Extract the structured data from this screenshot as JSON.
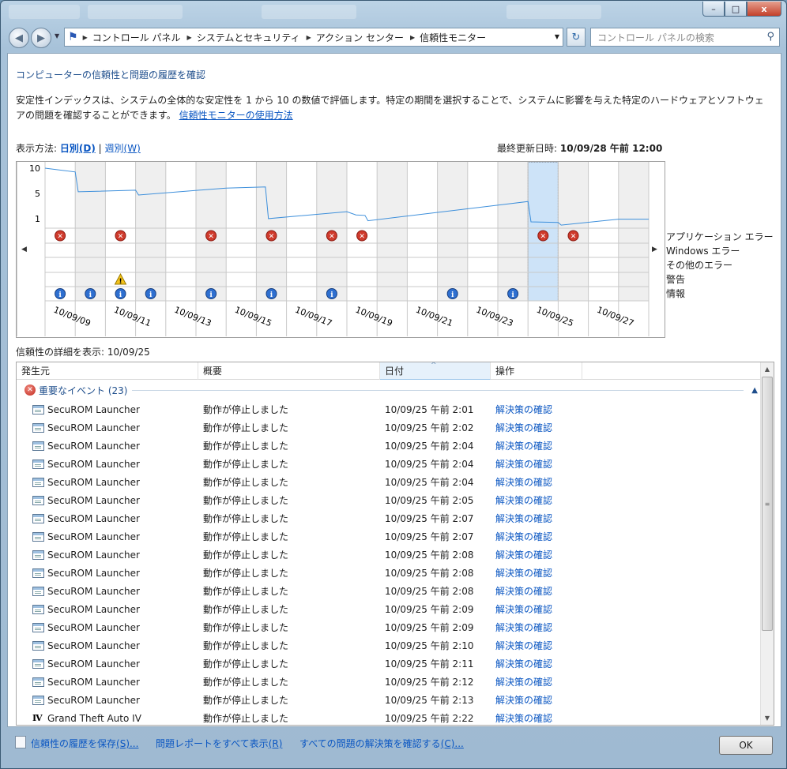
{
  "window": {
    "breadcrumbs": [
      "コントロール パネル",
      "システムとセキュリティ",
      "アクション センター",
      "信頼性モニター"
    ],
    "search_placeholder": "コントロール パネルの検索",
    "controls": {
      "minimize": "–",
      "maximize": "□",
      "close": "x"
    }
  },
  "page": {
    "title": "コンピューターの信頼性と問題の履歴を確認",
    "description": "安定性インデックスは、システムの全体的な安定性を 1 から 10 の数値で評価します。特定の期間を選択することで、システムに影響を与えた特定のハードウェアとソフトウェアの問題を確認することができます。",
    "help_link": "信頼性モニターの使用方法",
    "view_by_label": "表示方法:",
    "view_daily": "日別",
    "view_daily_key": "(D)",
    "view_weekly": "週別",
    "view_weekly_key": "(W)",
    "view_sep": "|",
    "last_updated_label": "最終更新日時:",
    "last_updated_value": "10/09/28 午前 12:00",
    "details_label": "信頼性の詳細を表示: 10/09/25"
  },
  "chart_data": {
    "type": "line",
    "y_ticks": [
      "10",
      "5",
      "1"
    ],
    "ylim": [
      1,
      10
    ],
    "x_labels": [
      "10/09/09",
      "10/09/11",
      "10/09/13",
      "10/09/15",
      "10/09/17",
      "10/09/19",
      "10/09/21",
      "10/09/23",
      "10/09/25",
      "10/09/27"
    ],
    "days": 20,
    "selected_day_index": 16,
    "stability_points": [
      [
        0,
        10
      ],
      [
        1,
        9.3
      ],
      [
        1.1,
        5.6
      ],
      [
        3,
        5.9
      ],
      [
        3.1,
        5.0
      ],
      [
        6,
        6.3
      ],
      [
        7.3,
        6.5
      ],
      [
        7.4,
        0.6
      ],
      [
        10,
        1.9
      ],
      [
        10.3,
        1.3
      ],
      [
        10.6,
        1.2
      ],
      [
        10.7,
        0.2
      ],
      [
        16,
        3.8
      ],
      [
        16.1,
        0.0
      ],
      [
        17,
        -0.1
      ],
      [
        17.1,
        -0.6
      ],
      [
        19,
        0.5
      ],
      [
        20,
        0.5
      ]
    ],
    "legend": [
      "アプリケーション エラー",
      "Windows エラー",
      "その他のエラー",
      "警告",
      "情報"
    ],
    "events": {
      "application_errors": [
        0,
        2,
        5,
        7,
        9,
        10,
        16,
        17
      ],
      "windows_errors": [],
      "other_errors": [],
      "warnings": [
        2
      ],
      "information": [
        0,
        1,
        2,
        3,
        5,
        7,
        9,
        13,
        15
      ]
    },
    "series": [
      {
        "name": "安定性インデックス",
        "color": "#3d8fdb"
      }
    ]
  },
  "table": {
    "columns": [
      "発生元",
      "概要",
      "日付",
      "操作"
    ],
    "group_label": "重要なイベント (23)",
    "rows": [
      {
        "source": "SecuROM Launcher",
        "summary": "動作が停止しました",
        "date": "10/09/25 午前 2:01",
        "action": "解決策の確認",
        "icon": "app-icon"
      },
      {
        "source": "SecuROM Launcher",
        "summary": "動作が停止しました",
        "date": "10/09/25 午前 2:02",
        "action": "解決策の確認",
        "icon": "app-icon"
      },
      {
        "source": "SecuROM Launcher",
        "summary": "動作が停止しました",
        "date": "10/09/25 午前 2:04",
        "action": "解決策の確認",
        "icon": "app-icon"
      },
      {
        "source": "SecuROM Launcher",
        "summary": "動作が停止しました",
        "date": "10/09/25 午前 2:04",
        "action": "解決策の確認",
        "icon": "app-icon"
      },
      {
        "source": "SecuROM Launcher",
        "summary": "動作が停止しました",
        "date": "10/09/25 午前 2:04",
        "action": "解決策の確認",
        "icon": "app-icon"
      },
      {
        "source": "SecuROM Launcher",
        "summary": "動作が停止しました",
        "date": "10/09/25 午前 2:05",
        "action": "解決策の確認",
        "icon": "app-icon"
      },
      {
        "source": "SecuROM Launcher",
        "summary": "動作が停止しました",
        "date": "10/09/25 午前 2:07",
        "action": "解決策の確認",
        "icon": "app-icon"
      },
      {
        "source": "SecuROM Launcher",
        "summary": "動作が停止しました",
        "date": "10/09/25 午前 2:07",
        "action": "解決策の確認",
        "icon": "app-icon"
      },
      {
        "source": "SecuROM Launcher",
        "summary": "動作が停止しました",
        "date": "10/09/25 午前 2:08",
        "action": "解決策の確認",
        "icon": "app-icon"
      },
      {
        "source": "SecuROM Launcher",
        "summary": "動作が停止しました",
        "date": "10/09/25 午前 2:08",
        "action": "解決策の確認",
        "icon": "app-icon"
      },
      {
        "source": "SecuROM Launcher",
        "summary": "動作が停止しました",
        "date": "10/09/25 午前 2:08",
        "action": "解決策の確認",
        "icon": "app-icon"
      },
      {
        "source": "SecuROM Launcher",
        "summary": "動作が停止しました",
        "date": "10/09/25 午前 2:09",
        "action": "解決策の確認",
        "icon": "app-icon"
      },
      {
        "source": "SecuROM Launcher",
        "summary": "動作が停止しました",
        "date": "10/09/25 午前 2:09",
        "action": "解決策の確認",
        "icon": "app-icon"
      },
      {
        "source": "SecuROM Launcher",
        "summary": "動作が停止しました",
        "date": "10/09/25 午前 2:10",
        "action": "解決策の確認",
        "icon": "app-icon"
      },
      {
        "source": "SecuROM Launcher",
        "summary": "動作が停止しました",
        "date": "10/09/25 午前 2:11",
        "action": "解決策の確認",
        "icon": "app-icon"
      },
      {
        "source": "SecuROM Launcher",
        "summary": "動作が停止しました",
        "date": "10/09/25 午前 2:12",
        "action": "解決策の確認",
        "icon": "app-icon"
      },
      {
        "source": "SecuROM Launcher",
        "summary": "動作が停止しました",
        "date": "10/09/25 午前 2:13",
        "action": "解決策の確認",
        "icon": "app-icon"
      },
      {
        "source": "Grand Theft Auto IV",
        "summary": "動作が停止しました",
        "date": "10/09/25 午前 2:22",
        "action": "解決策の確認",
        "icon": "gta-icon"
      }
    ]
  },
  "footer": {
    "save_history": "信頼性の履歴を保存",
    "save_history_key": "(S)...",
    "view_all_reports": "問題レポートをすべて表示",
    "view_all_reports_key": "(R)",
    "check_all_solutions": "すべての問題の解決策を確認する",
    "check_all_solutions_key": "(C)...",
    "ok": "OK"
  },
  "gta_icon_text": "IV"
}
